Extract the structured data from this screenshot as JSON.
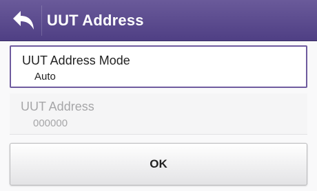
{
  "header": {
    "title": "UUT Address",
    "back_icon": "back-arrow-icon",
    "background_color": "#5a4a8c"
  },
  "settings": [
    {
      "label": "UUT Address Mode",
      "value": "Auto",
      "state": "selected",
      "accent_color": "#6e5a9e"
    },
    {
      "label": "UUT Address",
      "value": "000000",
      "state": "disabled"
    }
  ],
  "ok_button": {
    "label": "OK"
  }
}
